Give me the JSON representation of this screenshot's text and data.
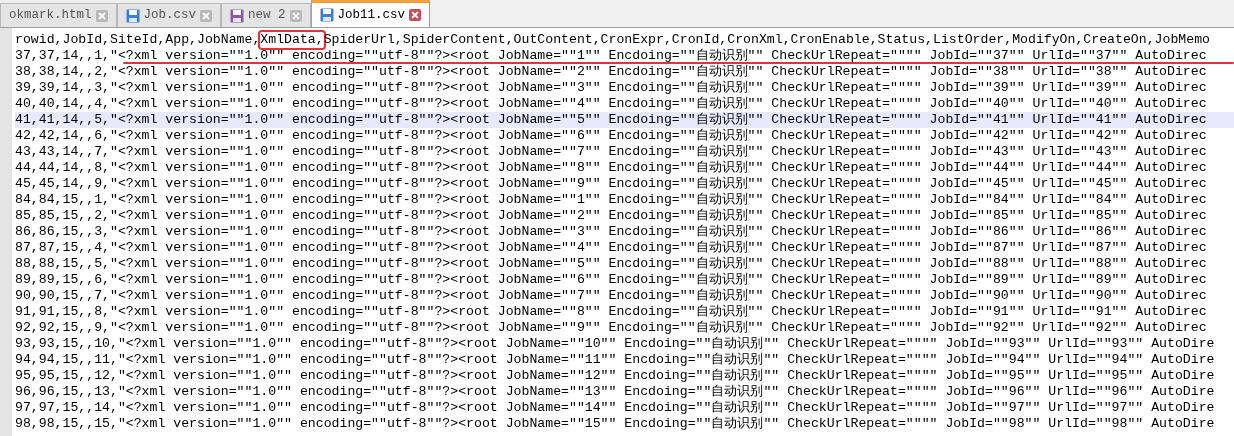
{
  "tabs": [
    {
      "label": "okmark.html",
      "selected": false
    },
    {
      "label": "Job.csv",
      "selected": false,
      "color": "#3d7fd6"
    },
    {
      "label": "new 2",
      "selected": false,
      "color": "#8a5aa8"
    },
    {
      "label": "Job11.csv",
      "selected": true,
      "color": "#3d7fd6"
    }
  ],
  "header": {
    "before": "rowid,JobId,SiteId,App,JobName,",
    "boxed": "XmlData,",
    "after": "SpiderUrl,SpiderContent,OutContent,CronExpr,CronId,CronXml,CronEnable,Status,ListOrder,ModifyOn,CreateOn,JobMemo"
  },
  "lines": [
    {
      "text": "37,37,14,,1,\"<?xml version=\"\"1.0\"\" encoding=\"\"utf-8\"\"?><root JobName=\"\"1\"\" Encdoing=\"\"自动识别\"\" CheckUrlRepeat=\"\"\"\" JobId=\"\"37\"\" UrlId=\"\"37\"\" AutoDirec",
      "selected": false,
      "underlined": true
    },
    {
      "text": "38,38,14,,2,\"<?xml version=\"\"1.0\"\" encoding=\"\"utf-8\"\"?><root JobName=\"\"2\"\" Encdoing=\"\"自动识别\"\" CheckUrlRepeat=\"\"\"\" JobId=\"\"38\"\" UrlId=\"\"38\"\" AutoDirec",
      "selected": false,
      "underlined": false
    },
    {
      "text": "39,39,14,,3,\"<?xml version=\"\"1.0\"\" encoding=\"\"utf-8\"\"?><root JobName=\"\"3\"\" Encdoing=\"\"自动识别\"\" CheckUrlRepeat=\"\"\"\" JobId=\"\"39\"\" UrlId=\"\"39\"\" AutoDirec",
      "selected": false,
      "underlined": false
    },
    {
      "text": "40,40,14,,4,\"<?xml version=\"\"1.0\"\" encoding=\"\"utf-8\"\"?><root JobName=\"\"4\"\" Encdoing=\"\"自动识别\"\" CheckUrlRepeat=\"\"\"\" JobId=\"\"40\"\" UrlId=\"\"40\"\" AutoDirec",
      "selected": false,
      "underlined": false
    },
    {
      "text": "41,41,14,,5,\"<?xml version=\"\"1.0\"\" encoding=\"\"utf-8\"\"?><root JobName=\"\"5\"\" Encdoing=\"\"自动识别\"\" CheckUrlRepeat=\"\"\"\" JobId=\"\"41\"\" UrlId=\"\"41\"\" AutoDirec",
      "selected": true,
      "underlined": false
    },
    {
      "text": "42,42,14,,6,\"<?xml version=\"\"1.0\"\" encoding=\"\"utf-8\"\"?><root JobName=\"\"6\"\" Encdoing=\"\"自动识别\"\" CheckUrlRepeat=\"\"\"\" JobId=\"\"42\"\" UrlId=\"\"42\"\" AutoDirec",
      "selected": false,
      "underlined": false
    },
    {
      "text": "43,43,14,,7,\"<?xml version=\"\"1.0\"\" encoding=\"\"utf-8\"\"?><root JobName=\"\"7\"\" Encdoing=\"\"自动识别\"\" CheckUrlRepeat=\"\"\"\" JobId=\"\"43\"\" UrlId=\"\"43\"\" AutoDirec",
      "selected": false,
      "underlined": false
    },
    {
      "text": "44,44,14,,8,\"<?xml version=\"\"1.0\"\" encoding=\"\"utf-8\"\"?><root JobName=\"\"8\"\" Encdoing=\"\"自动识别\"\" CheckUrlRepeat=\"\"\"\" JobId=\"\"44\"\" UrlId=\"\"44\"\" AutoDirec",
      "selected": false,
      "underlined": false
    },
    {
      "text": "45,45,14,,9,\"<?xml version=\"\"1.0\"\" encoding=\"\"utf-8\"\"?><root JobName=\"\"9\"\" Encdoing=\"\"自动识别\"\" CheckUrlRepeat=\"\"\"\" JobId=\"\"45\"\" UrlId=\"\"45\"\" AutoDirec",
      "selected": false,
      "underlined": false
    },
    {
      "text": "84,84,15,,1,\"<?xml version=\"\"1.0\"\" encoding=\"\"utf-8\"\"?><root JobName=\"\"1\"\" Encdoing=\"\"自动识别\"\" CheckUrlRepeat=\"\"\"\" JobId=\"\"84\"\" UrlId=\"\"84\"\" AutoDirec",
      "selected": false,
      "underlined": false
    },
    {
      "text": "85,85,15,,2,\"<?xml version=\"\"1.0\"\" encoding=\"\"utf-8\"\"?><root JobName=\"\"2\"\" Encdoing=\"\"自动识别\"\" CheckUrlRepeat=\"\"\"\" JobId=\"\"85\"\" UrlId=\"\"85\"\" AutoDirec",
      "selected": false,
      "underlined": false
    },
    {
      "text": "86,86,15,,3,\"<?xml version=\"\"1.0\"\" encoding=\"\"utf-8\"\"?><root JobName=\"\"3\"\" Encdoing=\"\"自动识别\"\" CheckUrlRepeat=\"\"\"\" JobId=\"\"86\"\" UrlId=\"\"86\"\" AutoDirec",
      "selected": false,
      "underlined": false
    },
    {
      "text": "87,87,15,,4,\"<?xml version=\"\"1.0\"\" encoding=\"\"utf-8\"\"?><root JobName=\"\"4\"\" Encdoing=\"\"自动识别\"\" CheckUrlRepeat=\"\"\"\" JobId=\"\"87\"\" UrlId=\"\"87\"\" AutoDirec",
      "selected": false,
      "underlined": false
    },
    {
      "text": "88,88,15,,5,\"<?xml version=\"\"1.0\"\" encoding=\"\"utf-8\"\"?><root JobName=\"\"5\"\" Encdoing=\"\"自动识别\"\" CheckUrlRepeat=\"\"\"\" JobId=\"\"88\"\" UrlId=\"\"88\"\" AutoDirec",
      "selected": false,
      "underlined": false
    },
    {
      "text": "89,89,15,,6,\"<?xml version=\"\"1.0\"\" encoding=\"\"utf-8\"\"?><root JobName=\"\"6\"\" Encdoing=\"\"自动识别\"\" CheckUrlRepeat=\"\"\"\" JobId=\"\"89\"\" UrlId=\"\"89\"\" AutoDirec",
      "selected": false,
      "underlined": false
    },
    {
      "text": "90,90,15,,7,\"<?xml version=\"\"1.0\"\" encoding=\"\"utf-8\"\"?><root JobName=\"\"7\"\" Encdoing=\"\"自动识别\"\" CheckUrlRepeat=\"\"\"\" JobId=\"\"90\"\" UrlId=\"\"90\"\" AutoDirec",
      "selected": false,
      "underlined": false
    },
    {
      "text": "91,91,15,,8,\"<?xml version=\"\"1.0\"\" encoding=\"\"utf-8\"\"?><root JobName=\"\"8\"\" Encdoing=\"\"自动识别\"\" CheckUrlRepeat=\"\"\"\" JobId=\"\"91\"\" UrlId=\"\"91\"\" AutoDirec",
      "selected": false,
      "underlined": false
    },
    {
      "text": "92,92,15,,9,\"<?xml version=\"\"1.0\"\" encoding=\"\"utf-8\"\"?><root JobName=\"\"9\"\" Encdoing=\"\"自动识别\"\" CheckUrlRepeat=\"\"\"\" JobId=\"\"92\"\" UrlId=\"\"92\"\" AutoDirec",
      "selected": false,
      "underlined": false
    },
    {
      "text": "93,93,15,,10,\"<?xml version=\"\"1.0\"\" encoding=\"\"utf-8\"\"?><root JobName=\"\"10\"\" Encdoing=\"\"自动识别\"\" CheckUrlRepeat=\"\"\"\" JobId=\"\"93\"\" UrlId=\"\"93\"\" AutoDire",
      "selected": false,
      "underlined": false
    },
    {
      "text": "94,94,15,,11,\"<?xml version=\"\"1.0\"\" encoding=\"\"utf-8\"\"?><root JobName=\"\"11\"\" Encdoing=\"\"自动识别\"\" CheckUrlRepeat=\"\"\"\" JobId=\"\"94\"\" UrlId=\"\"94\"\" AutoDire",
      "selected": false,
      "underlined": false
    },
    {
      "text": "95,95,15,,12,\"<?xml version=\"\"1.0\"\" encoding=\"\"utf-8\"\"?><root JobName=\"\"12\"\" Encdoing=\"\"自动识别\"\" CheckUrlRepeat=\"\"\"\" JobId=\"\"95\"\" UrlId=\"\"95\"\" AutoDire",
      "selected": false,
      "underlined": false
    },
    {
      "text": "96,96,15,,13,\"<?xml version=\"\"1.0\"\" encoding=\"\"utf-8\"\"?><root JobName=\"\"13\"\" Encdoing=\"\"自动识别\"\" CheckUrlRepeat=\"\"\"\" JobId=\"\"96\"\" UrlId=\"\"96\"\" AutoDire",
      "selected": false,
      "underlined": false
    },
    {
      "text": "97,97,15,,14,\"<?xml version=\"\"1.0\"\" encoding=\"\"utf-8\"\"?><root JobName=\"\"14\"\" Encdoing=\"\"自动识别\"\" CheckUrlRepeat=\"\"\"\" JobId=\"\"97\"\" UrlId=\"\"97\"\" AutoDire",
      "selected": false,
      "underlined": false
    },
    {
      "text": "98,98,15,,15,\"<?xml version=\"\"1.0\"\" encoding=\"\"utf-8\"\"?><root JobName=\"\"15\"\" Encdoing=\"\"自动识别\"\" CheckUrlRepeat=\"\"\"\" JobId=\"\"98\"\" UrlId=\"\"98\"\" AutoDire",
      "selected": false,
      "underlined": false
    }
  ]
}
